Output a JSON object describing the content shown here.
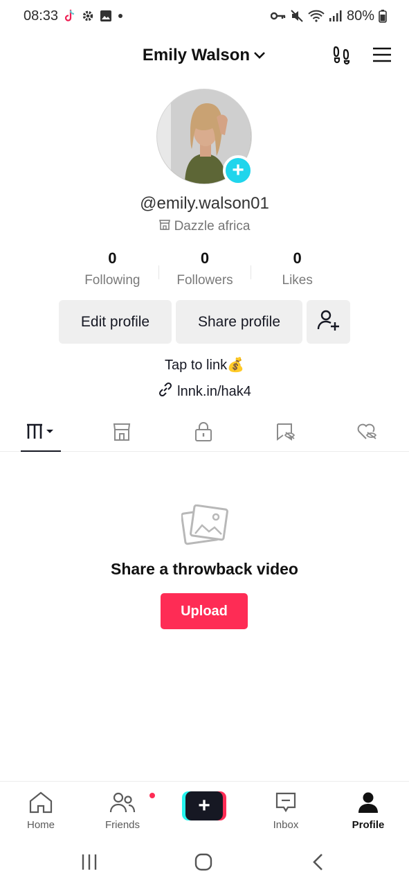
{
  "status_bar": {
    "time": "08:33",
    "battery": "80%"
  },
  "header": {
    "account_name": "Emily Walson"
  },
  "profile": {
    "username": "@emily.walson01",
    "shop_name": "Dazzle africa",
    "stats": [
      {
        "value": "0",
        "label": "Following"
      },
      {
        "value": "0",
        "label": "Followers"
      },
      {
        "value": "0",
        "label": "Likes"
      }
    ],
    "edit_label": "Edit profile",
    "share_label": "Share profile",
    "bio": "Tap to link💰",
    "link": "lnnk.in/hak4"
  },
  "tabs": [
    "videos-grid",
    "shop",
    "private",
    "favorites",
    "liked"
  ],
  "empty_state": {
    "title": "Share a throwback video",
    "upload_label": "Upload"
  },
  "bottom_nav": [
    {
      "label": "Home"
    },
    {
      "label": "Friends"
    },
    {
      "label": "Inbox"
    },
    {
      "label": "Profile"
    }
  ],
  "colors": {
    "accent": "#fe2c55",
    "cyan": "#25f4ee",
    "avatar_plus": "#20d5ec"
  }
}
